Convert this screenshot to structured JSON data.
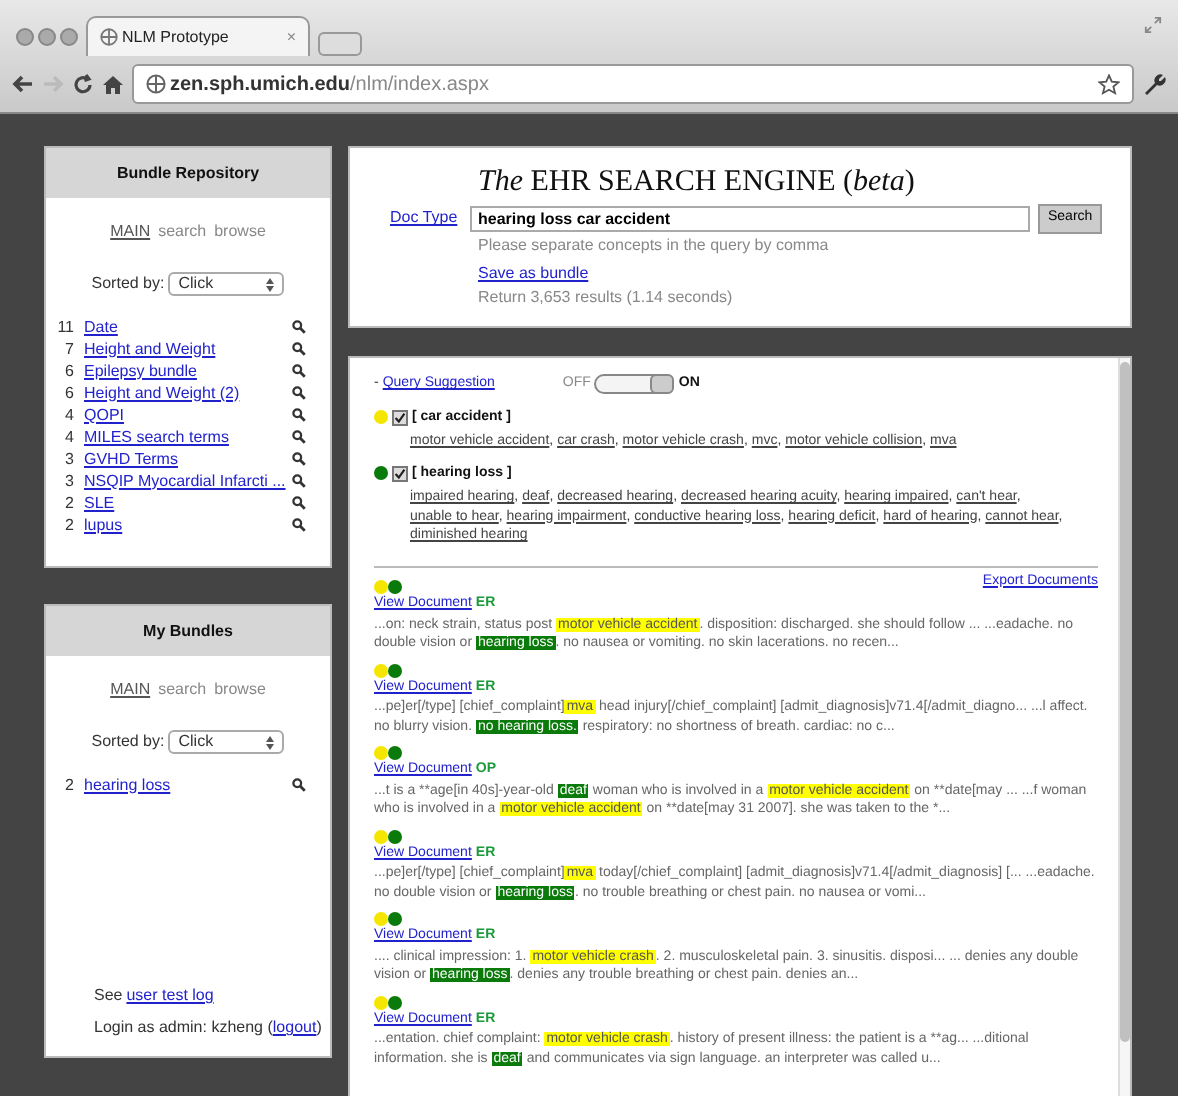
{
  "browser": {
    "tab_title": "NLM Prototype",
    "tab_close": "×",
    "url_host": "zen.sph.umich.edu",
    "url_path": "/nlm/index.aspx",
    "forward_disabled": true
  },
  "bundle_repository": {
    "title": "Bundle Repository",
    "nav": [
      {
        "label": "MAIN",
        "selected": true
      },
      {
        "label": "search",
        "selected": false
      },
      {
        "label": "browse",
        "selected": false
      }
    ],
    "sort_label": "Sorted by:",
    "sort_value": "Click",
    "items": [
      {
        "count": "11",
        "name": "Date"
      },
      {
        "count": "7",
        "name": "Height and Weight"
      },
      {
        "count": "6",
        "name": "Epilepsy bundle"
      },
      {
        "count": "6",
        "name": "Height and Weight (2)"
      },
      {
        "count": "4",
        "name": "QOPI"
      },
      {
        "count": "4",
        "name": "MILES search terms"
      },
      {
        "count": "3",
        "name": "GVHD Terms"
      },
      {
        "count": "3",
        "name": "NSQIP Myocardial Infarcti ..."
      },
      {
        "count": "2",
        "name": "SLE"
      },
      {
        "count": "2",
        "name": "lupus"
      }
    ]
  },
  "my_bundles": {
    "title": "My Bundles",
    "nav": [
      {
        "label": "MAIN",
        "selected": true
      },
      {
        "label": "search",
        "selected": false
      },
      {
        "label": "browse",
        "selected": false
      }
    ],
    "sort_label": "Sorted by:",
    "sort_value": "Click",
    "items": [
      {
        "count": "2",
        "name": "hearing loss"
      }
    ],
    "footer_see": "See",
    "footer_link": "user test log",
    "login_text": "Login as admin: kzheng (",
    "logout": "logout",
    "login_close": ")"
  },
  "header": {
    "title": "*The* EHR SEARCH ENGINE (*beta*)",
    "doc_type": "Doc Type",
    "query": "hearing loss car accident",
    "search_button": "Search",
    "hint": "Please separate concepts in the query by comma",
    "save_bundle": "Save as bundle",
    "results_count": "Return 3,653 results (1.14 seconds)"
  },
  "query_suggestion": {
    "toggle_mark": "-",
    "separator": ",",
    "label": "Query Suggestion",
    "off_label": "OFF",
    "on_label": "ON",
    "on": true,
    "concepts": [
      {
        "color": "#f5e600",
        "checked": true,
        "label": "[ car accident ]",
        "synonyms": [
          "motor vehicle accident",
          "car crash",
          "motor vehicle crash",
          "mvc",
          "motor vehicle collision",
          "mva"
        ]
      },
      {
        "color": "#0a7a0a",
        "checked": true,
        "label": "[ hearing loss ]",
        "synonyms": [
          "impaired hearing",
          "deaf",
          "decreased hearing",
          "decreased hearing acuity",
          "hearing impaired",
          "can't hear",
          "unable to hear",
          "hearing impairment",
          "conductive hearing loss",
          "hearing deficit",
          "hard of hearing",
          "cannot hear",
          "diminished hearing"
        ]
      }
    ]
  },
  "export": "Export Documents",
  "results": [
    {
      "dots": [
        {
          "color": "#f5e600"
        },
        {
          "color": "#0a7a0a"
        }
      ],
      "link": "View Document",
      "type": "ER",
      "snippet": [
        {
          "text": "...on: neck strain, status post "
        },
        {
          "text": "motor vehicle accident",
          "color": "#ffff00"
        },
        {
          "text": ". disposition: discharged. she should follow ... ...eadache. no double vision or "
        },
        {
          "text": "hearing loss",
          "color": "#0a7a0a"
        },
        {
          "text": ". no nausea or vomiting. no skin lacerations. no recen..."
        }
      ]
    },
    {
      "dots": [
        {
          "color": "#f5e600"
        },
        {
          "color": "#0a7a0a"
        }
      ],
      "link": "View Document",
      "type": "ER",
      "snippet": [
        {
          "text": "...pe]er[/type] [chief_complaint]"
        },
        {
          "text": "mva",
          "color": "#ffff00"
        },
        {
          "text": " head injury[/chief_complaint] [admit_diagnosis]v71.4[/admit_diagno... ...l affect. no blurry vision. "
        },
        {
          "text": "no hearing loss.",
          "color": "#0a7a0a"
        },
        {
          "text": " respiratory: no shortness of breath. cardiac: no c..."
        }
      ]
    },
    {
      "dots": [
        {
          "color": "#f5e600"
        },
        {
          "color": "#0a7a0a"
        }
      ],
      "link": "View Document",
      "type": "OP",
      "snippet": [
        {
          "text": "...t is a **age[in 40s]-year-old "
        },
        {
          "text": "deaf",
          "color": "#0a7a0a"
        },
        {
          "text": " woman who is involved in a "
        },
        {
          "text": "motor vehicle accident",
          "color": "#ffff00"
        },
        {
          "text": " on **date[may ... ...f woman who is involved in a "
        },
        {
          "text": "motor vehicle accident",
          "color": "#ffff00"
        },
        {
          "text": " on **date[may 31 2007]. she was taken to the *..."
        }
      ]
    },
    {
      "dots": [
        {
          "color": "#f5e600"
        },
        {
          "color": "#0a7a0a"
        }
      ],
      "link": "View Document",
      "type": "ER",
      "snippet": [
        {
          "text": "...pe]er[/type] [chief_complaint]"
        },
        {
          "text": "mva",
          "color": "#ffff00"
        },
        {
          "text": " today[/chief_complaint] [admit_diagnosis]v71.4[/admit_diagnosis] [... ...eadache. no double vision or "
        },
        {
          "text": "hearing loss",
          "color": "#0a7a0a"
        },
        {
          "text": ". no trouble breathing or chest pain. no nausea or vomi..."
        }
      ]
    },
    {
      "dots": [
        {
          "color": "#f5e600"
        },
        {
          "color": "#0a7a0a"
        }
      ],
      "link": "View Document",
      "type": "ER",
      "snippet": [
        {
          "text": ".... clinical impression: 1. "
        },
        {
          "text": "motor vehicle crash",
          "color": "#ffff00"
        },
        {
          "text": ". 2. musculoskeletal pain. 3. sinusitis. disposi... ... denies any double vision or "
        },
        {
          "text": "hearing loss",
          "color": "#0a7a0a"
        },
        {
          "text": ". denies any trouble breathing or chest pain. denies an..."
        }
      ]
    },
    {
      "dots": [
        {
          "color": "#f5e600"
        },
        {
          "color": "#0a7a0a"
        }
      ],
      "link": "View Document",
      "type": "ER",
      "snippet": [
        {
          "text": "...entation. chief complaint: "
        },
        {
          "text": "motor vehicle crash",
          "color": "#ffff00"
        },
        {
          "text": ". history of present illness: the patient is a **ag... ...ditional information. she is "
        },
        {
          "text": "deaf",
          "color": "#0a7a0a"
        },
        {
          "text": " and communicates via sign language. an interpreter was called u..."
        }
      ]
    }
  ]
}
